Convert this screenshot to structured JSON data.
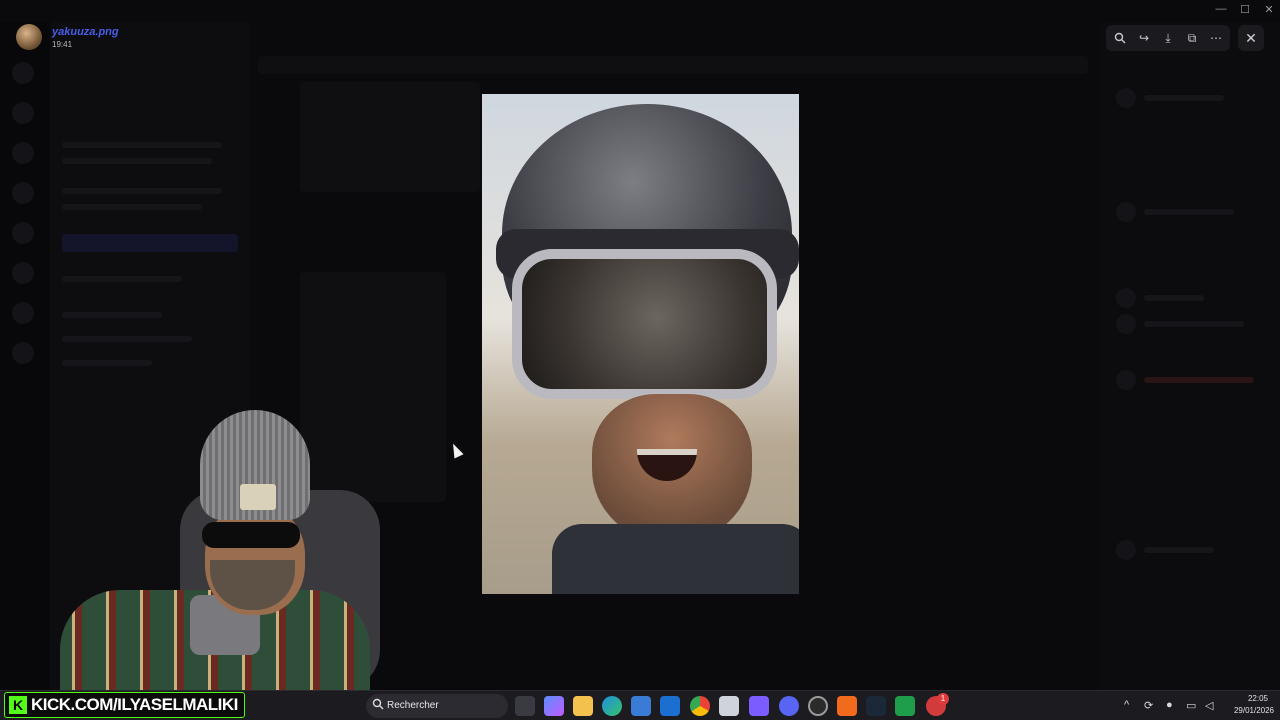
{
  "viewer": {
    "uploader_name": "yakuuza.png",
    "upload_time": "19:41",
    "toolbar": {
      "zoom_icon": "zoom-in-icon",
      "forward_icon": "forward-icon",
      "download_icon": "download-icon",
      "open_icon": "open-in-browser-icon",
      "more_icon": "more-icon",
      "close_icon": "close-icon"
    }
  },
  "overlay": {
    "kick_badge_text": "KICK.COM/ILYASELMALIKI",
    "kick_logo_letter": "K",
    "accent": "#53fc18"
  },
  "taskbar": {
    "search_label": "Rechercher",
    "notification_count": "1",
    "clock_time": "22:05",
    "clock_date": "29/01/2026"
  }
}
